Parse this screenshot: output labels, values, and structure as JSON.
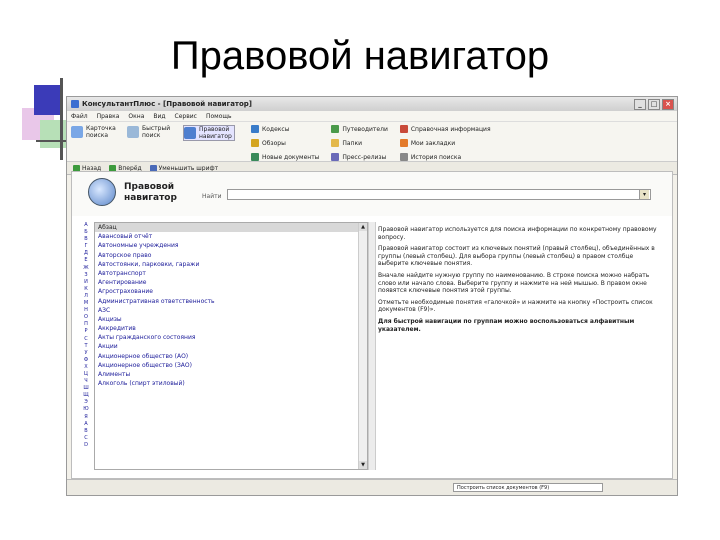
{
  "slide": {
    "title": "Правовой навигатор"
  },
  "window": {
    "title": "КонсультантПлюс - [Правовой навигатор]",
    "menu": [
      "Файл",
      "Правка",
      "Окна",
      "Вид",
      "Сервис",
      "Помощь"
    ],
    "toolbar_big": [
      {
        "label": "Карточка поиска",
        "icon": "search-card-icon"
      },
      {
        "label": "Быстрый поиск",
        "icon": "magnifier-icon"
      },
      {
        "label": "Правовой навигатор",
        "icon": "navigator-icon"
      }
    ],
    "toolbar_small": [
      {
        "label": "Кодексы",
        "icon": "code-icon"
      },
      {
        "label": "Путеводители",
        "icon": "guide-icon"
      },
      {
        "label": "Справочная информация",
        "icon": "reference-icon"
      },
      {
        "label": "Обзоры",
        "icon": "review-icon"
      },
      {
        "label": "Папки",
        "icon": "folder-icon"
      },
      {
        "label": "Мои закладки",
        "icon": "bookmark-icon"
      },
      {
        "label": "Новые документы",
        "icon": "new-docs-icon"
      },
      {
        "label": "Пресс-релизы",
        "icon": "press-icon"
      },
      {
        "label": "История поиска",
        "icon": "history-icon"
      }
    ],
    "toolbar_nav": [
      "Назад",
      "Вперёд",
      "Уменьшить шрифт"
    ]
  },
  "navigator": {
    "title_line1": "Правовой",
    "title_line2": "навигатор",
    "search_label": "Найти",
    "search_value": "",
    "alphabet": [
      "А",
      "Б",
      "В",
      "Г",
      "Д",
      "Е",
      "Ж",
      "З",
      "И",
      "К",
      "Л",
      "М",
      "Н",
      "О",
      "П",
      "Р",
      "С",
      "Т",
      "У",
      "Ф",
      "Х",
      "Ц",
      "Ч",
      "Ш",
      "Щ",
      "Э",
      "Ю",
      "Я",
      "A",
      "B",
      "C",
      "D"
    ],
    "items": [
      "Абзац",
      "Авансовый отчёт",
      "Автономные учреждения",
      "Авторское право",
      "Автостоянки, парковки, гаражи",
      "Автотранспорт",
      "Агентирование",
      "Агрострахование",
      "Административная ответственность",
      "АЗС",
      "Акцизы",
      "Аккредитив",
      "Акты гражданского состояния",
      "Акции",
      "Акционерное общество (АО)",
      "Акционерное общество (ЗАО)",
      "Алименты",
      "Алкоголь (спирт этиловый)"
    ],
    "help": [
      "Правовой навигатор используется для поиска информации по конкретному правовому вопросу.",
      "Правовой навигатор состоит из ключевых понятий (правый столбец), объединённых в группы (левый столбец). Для выбора группы (левый столбец) в правом столбце выберите ключевые понятия.",
      "Вначале найдите нужную группу по наименованию. В строке поиска можно набрать слово или начало слова. Выберите группу и нажмите на ней мышью. В правом окне появятся ключевые понятия этой группы.",
      "Отметьте необходимые понятия «галочкой» и нажмите на кнопку «Построить список документов (F9)».",
      "Для быстрой навигации по группам можно воспользоваться алфавитным указателем."
    ],
    "status_button": "Построить список документов (F9)"
  }
}
